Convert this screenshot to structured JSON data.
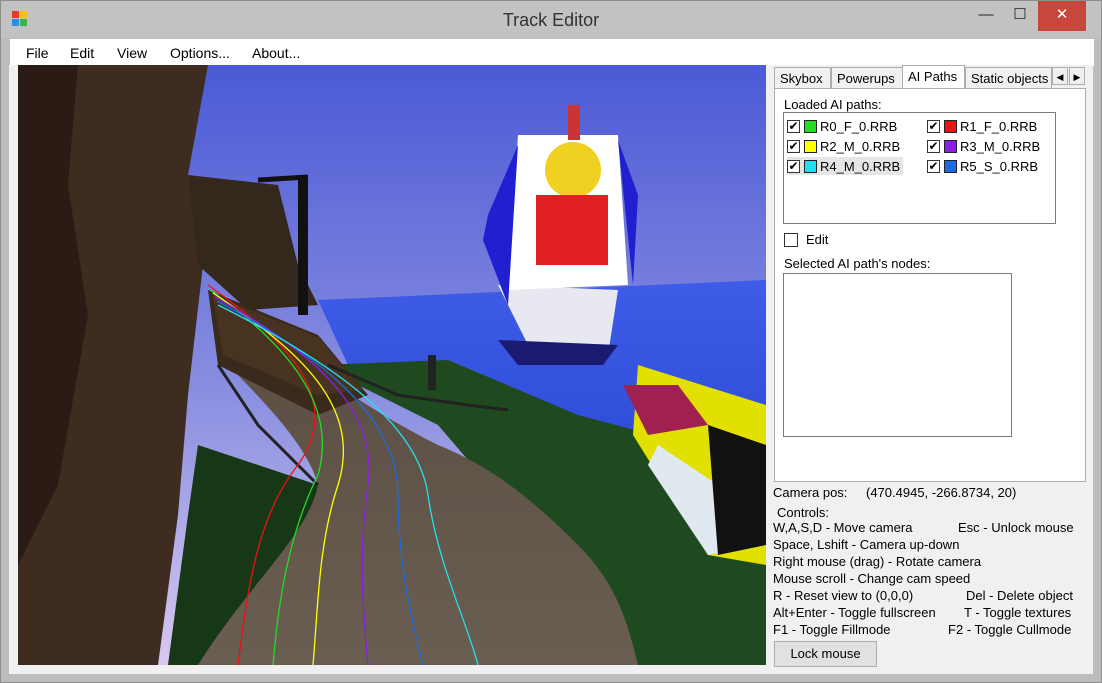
{
  "window": {
    "title": "Track Editor",
    "minimize": "—",
    "maximize": "☐",
    "close": "✕"
  },
  "menu": {
    "file": "File",
    "edit": "Edit",
    "view": "View",
    "options": "Options...",
    "about": "About..."
  },
  "tabs": {
    "skybox": "Skybox",
    "powerups": "Powerups",
    "ai_paths": "AI Paths",
    "static_objects": "Static objects",
    "prev": "◀",
    "next": "▶"
  },
  "ai_panel": {
    "loaded_label": "Loaded AI paths:",
    "paths": [
      {
        "name": "R0_F_0.RRB",
        "color": "#22dd22",
        "checked": true
      },
      {
        "name": "R1_F_0.RRB",
        "color": "#ee1111",
        "checked": true
      },
      {
        "name": "R2_M_0.RRB",
        "color": "#ffff00",
        "checked": true
      },
      {
        "name": "R3_M_0.RRB",
        "color": "#8a1ee6",
        "checked": true
      },
      {
        "name": "R4_M_0.RRB",
        "color": "#22e0f0",
        "checked": true
      },
      {
        "name": "R5_S_0.RRB",
        "color": "#1a6be0",
        "checked": true
      }
    ],
    "check_mark": "✔",
    "edit_label": "Edit",
    "edit_checked": false,
    "nodes_label": "Selected AI path's nodes:"
  },
  "info": {
    "camera_label": "Camera pos:",
    "camera_value": "(470.4945, -266.8734, 20)",
    "controls_label": "Controls:",
    "l1a": "W,A,S,D - Move camera",
    "l1b": "Esc - Unlock mouse",
    "l2": "Space, Lshift - Camera up-down",
    "l3": "Right mouse (drag) - Rotate camera",
    "l4": "Mouse scroll - Change cam speed",
    "l5a": "R - Reset view to (0,0,0)",
    "l5b": "Del - Delete object",
    "l6a": "Alt+Enter - Toggle fullscreen",
    "l6b": "T - Toggle textures",
    "l7a": "F1 - Toggle Fillmode",
    "l7b": "F2 - Toggle Cullmode"
  },
  "lock_button": "Lock mouse"
}
